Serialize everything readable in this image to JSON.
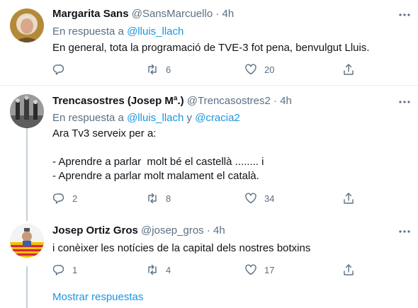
{
  "tweets": [
    {
      "name": "Margarita Sans",
      "handle": "@SansMarcuello",
      "dot": "·",
      "time": "4h",
      "reply_prefix": "En respuesta a ",
      "reply_mention_1": "@lluis_llach",
      "reply_join": "",
      "reply_mention_2": "",
      "text": "En general, tota la programació de TVE-3 fot pena, benvulgut Lluis.",
      "replies": "",
      "retweets": "6",
      "likes": "20",
      "icons": [
        "reply-icon",
        "retweet-icon",
        "like-icon",
        "share-icon",
        "more-icon"
      ]
    },
    {
      "name": "Trencasostres (Josep Mª.)",
      "handle": "@Trencasostres2",
      "dot": "·",
      "time": "4h",
      "reply_prefix": "En respuesta a ",
      "reply_mention_1": "@lluis_llach",
      "reply_join": " y ",
      "reply_mention_2": "@cracia2",
      "text": "Ara Tv3 serveix per a:\n\n- Aprendre a parlar  molt bé el castellà ........ i\n- Aprendre a parlar molt malament el català.",
      "replies": "2",
      "retweets": "8",
      "likes": "34"
    },
    {
      "name": "Josep Ortiz Gros",
      "handle": "@josep_gros",
      "dot": "·",
      "time": "4h",
      "text": "i conèixer les notícies de la capital dels nostres botxins",
      "replies": "1",
      "retweets": "4",
      "likes": "17"
    }
  ],
  "show_replies": "Mostrar respuestas",
  "colors": {
    "accent": "#1b95e0",
    "secondary_text": "#5b7083",
    "thread_line": "#c4cfd6",
    "divider": "#e6ecf0"
  }
}
